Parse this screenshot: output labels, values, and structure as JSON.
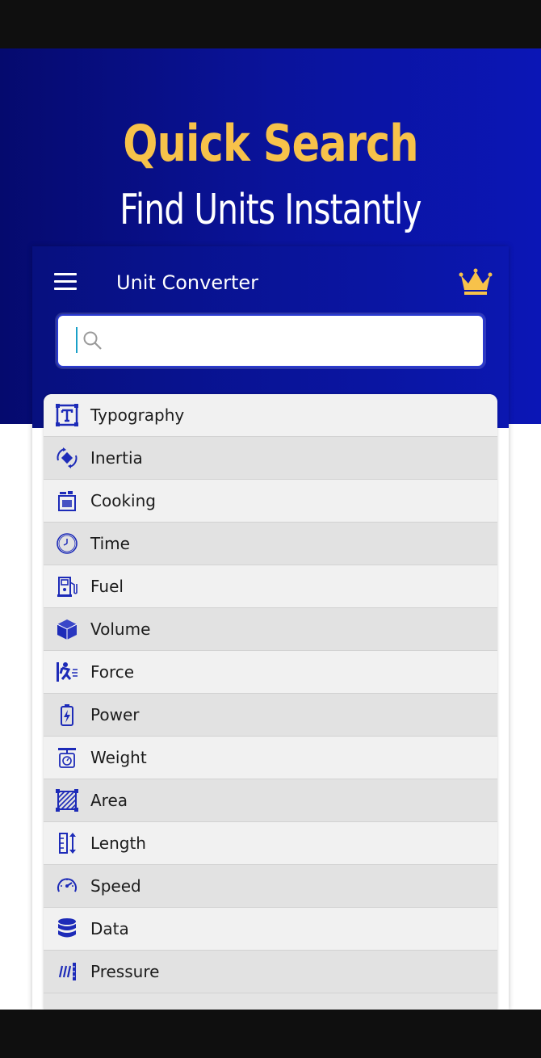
{
  "hero": {
    "title": "Quick Search",
    "subtitle": "Find Units Instantly"
  },
  "app": {
    "title": "Unit Converter",
    "menu_icon": "hamburger-menu-icon",
    "premium_icon": "crown-icon"
  },
  "search": {
    "value": "",
    "placeholder": "",
    "icon": "search-icon"
  },
  "categories": [
    {
      "label": "Typography",
      "icon": "typography-icon"
    },
    {
      "label": "Inertia",
      "icon": "inertia-icon"
    },
    {
      "label": "Cooking",
      "icon": "cooking-icon"
    },
    {
      "label": "Time",
      "icon": "clock-icon"
    },
    {
      "label": "Fuel",
      "icon": "fuel-pump-icon"
    },
    {
      "label": "Volume",
      "icon": "cube-icon"
    },
    {
      "label": "Force",
      "icon": "force-icon"
    },
    {
      "label": "Power",
      "icon": "battery-power-icon"
    },
    {
      "label": "Weight",
      "icon": "scale-icon"
    },
    {
      "label": "Area",
      "icon": "area-icon"
    },
    {
      "label": "Length",
      "icon": "length-icon"
    },
    {
      "label": "Speed",
      "icon": "speedometer-icon"
    },
    {
      "label": "Data",
      "icon": "database-icon"
    },
    {
      "label": "Pressure",
      "icon": "pressure-icon"
    }
  ],
  "colors": {
    "accent": "#1d2bb8",
    "hero_title": "#f7c24a",
    "crown": "#f7c24a"
  }
}
